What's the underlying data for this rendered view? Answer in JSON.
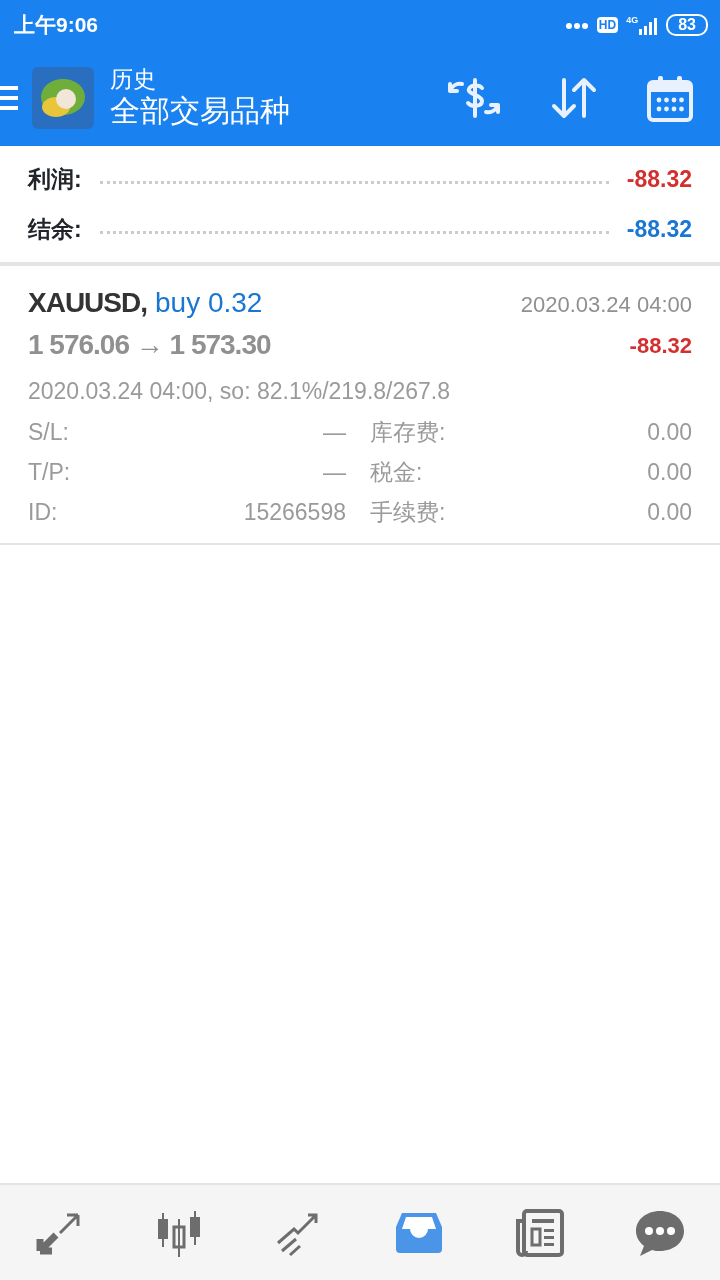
{
  "status_bar": {
    "time": "上午9:06",
    "hd": "HD",
    "network": "4G",
    "battery": "83"
  },
  "toolbar": {
    "title": "历史",
    "subtitle": "全部交易品种"
  },
  "summary": [
    {
      "label": "利润:",
      "value": "-88.32",
      "color": "#d32f2f"
    },
    {
      "label": "结余:",
      "value": "-88.32",
      "color": "#1976d2"
    }
  ],
  "deals": [
    {
      "symbol": "XAUUSD,",
      "side": "buy 0.32",
      "time": "2020.03.24 04:00",
      "prices": "1 576.06 → 1 573.30",
      "profit": "-88.32",
      "detail": "2020.03.24 04:00, so: 82.1%/219.8/267.8",
      "fields": [
        {
          "label": "S/L:",
          "value": "—",
          "label_2": "库存费:",
          "value_2": "0.00"
        },
        {
          "label": "T/P:",
          "value": "—",
          "label_2": "税金:",
          "value_2": "0.00"
        },
        {
          "label": "ID:",
          "value": "15266598",
          "label_2": "手续费:",
          "value_2": "0.00"
        }
      ]
    }
  ],
  "bottom_nav": [
    {
      "kind": "quotes",
      "selected": false
    },
    {
      "kind": "chart",
      "selected": false
    },
    {
      "kind": "trade",
      "selected": false
    },
    {
      "kind": "history",
      "selected": true
    },
    {
      "kind": "news",
      "selected": false
    },
    {
      "kind": "chat",
      "selected": false
    }
  ]
}
